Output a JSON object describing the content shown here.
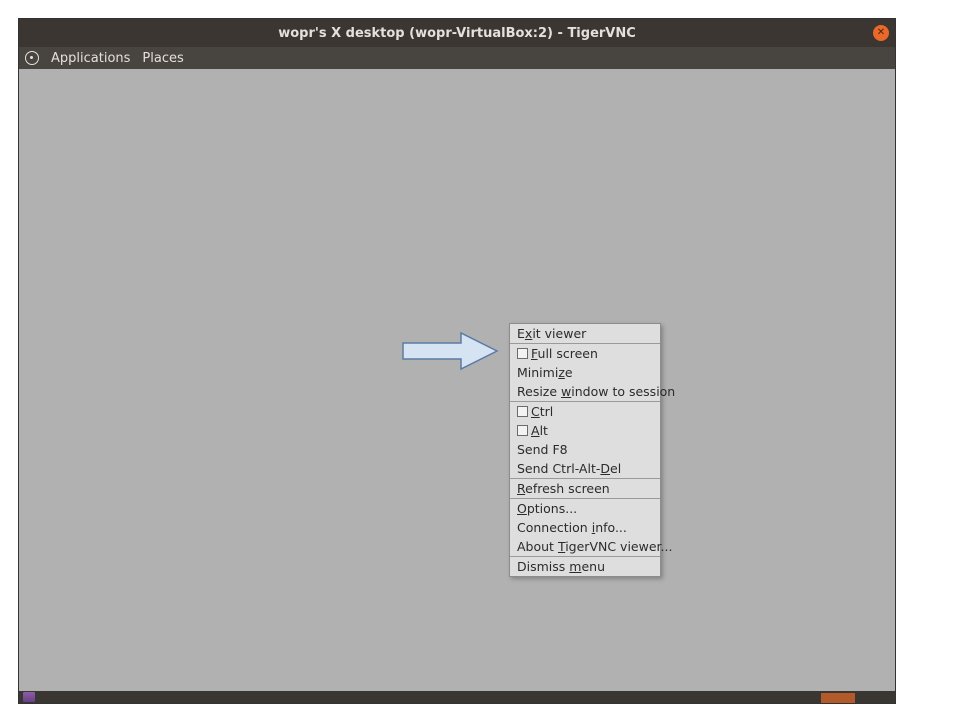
{
  "window": {
    "title": "wopr's X desktop (wopr-VirtualBox:2) - TigerVNC"
  },
  "menubar": {
    "applications": "Applications",
    "places": "Places"
  },
  "context_menu": {
    "exit": {
      "pre": "E",
      "mn": "x",
      "post": "it viewer"
    },
    "fullscreen": {
      "pre": "",
      "mn": "F",
      "post": "ull screen",
      "checked": false
    },
    "minimize": {
      "pre": "Minimi",
      "mn": "z",
      "post": "e"
    },
    "resize": {
      "pre": "Resize ",
      "mn": "w",
      "post": "indow to session"
    },
    "ctrl": {
      "pre": "",
      "mn": "C",
      "post": "trl",
      "checked": false
    },
    "alt": {
      "pre": "",
      "mn": "A",
      "post": "lt",
      "checked": false
    },
    "sendf8": {
      "label": "Send F8"
    },
    "sendcad": {
      "pre": "Send Ctrl-Alt-",
      "mn": "D",
      "post": "el"
    },
    "refresh": {
      "pre": "",
      "mn": "R",
      "post": "efresh screen"
    },
    "options": {
      "pre": "",
      "mn": "O",
      "post": "ptions..."
    },
    "conninfo": {
      "pre": "Connection ",
      "mn": "i",
      "post": "nfo..."
    },
    "about": {
      "pre": "About ",
      "mn": "T",
      "post": "igerVNC viewer..."
    },
    "dismiss": {
      "pre": "Dismiss ",
      "mn": "m",
      "post": "enu"
    }
  },
  "annotation": {
    "arrow_fill": "#d6e3f3",
    "arrow_stroke": "#5b7ca3"
  }
}
